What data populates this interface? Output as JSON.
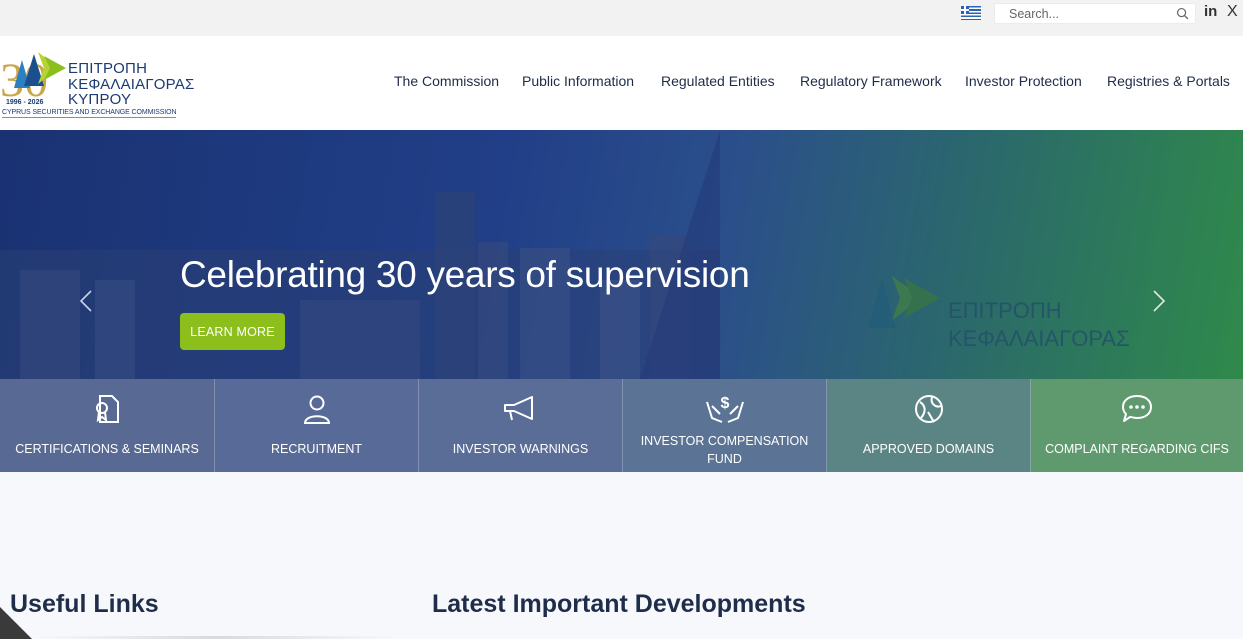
{
  "topbar": {
    "language_flag": "greek-flag-icon",
    "search_placeholder": "Search...",
    "social": {
      "linkedin": "in",
      "x": "X"
    }
  },
  "logo": {
    "anniversary": "30",
    "years": "1996 - 2026",
    "line1": "ΕΠΙΤΡΟΠΗ",
    "line2": "ΚΕΦΑΛΑΙΑΓΟΡΑΣ",
    "line3": "ΚΥΠΡΟΥ",
    "english": "CYPRUS SECURITIES AND EXCHANGE COMMISSION"
  },
  "nav": [
    "The Commission",
    "Public Information",
    "Regulated Entities",
    "Regulatory Framework",
    "Investor Protection",
    "Registries & Portals"
  ],
  "hero": {
    "title": "Celebrating 30 years of supervision",
    "button": "LEARN MORE",
    "background_text_1": "ΕΠΙΤΡΟΠΗ",
    "background_text_2": "ΚΕΦΑΛΑΙΑΓΟΡΑΣ"
  },
  "tiles": [
    {
      "label": "CERTIFICATIONS & SEMINARS",
      "icon": "certificate-icon"
    },
    {
      "label": "RECRUITMENT",
      "icon": "user-icon"
    },
    {
      "label": "INVESTOR WARNINGS",
      "icon": "megaphone-icon"
    },
    {
      "label_line1": "INVESTOR COMPENSATION",
      "label_line2": "FUND",
      "icon": "hands-dollar-icon"
    },
    {
      "label": "APPROVED DOMAINS",
      "icon": "globe-icon"
    },
    {
      "label": "COMPLAINT REGARDING CIFS",
      "icon": "chat-bubble-icon"
    }
  ],
  "sections": {
    "useful_links": "Useful Links",
    "latest": "Latest Important Developments"
  },
  "colors": {
    "accent_green": "#8cbf1c",
    "brand_navy": "#1c3b72"
  }
}
